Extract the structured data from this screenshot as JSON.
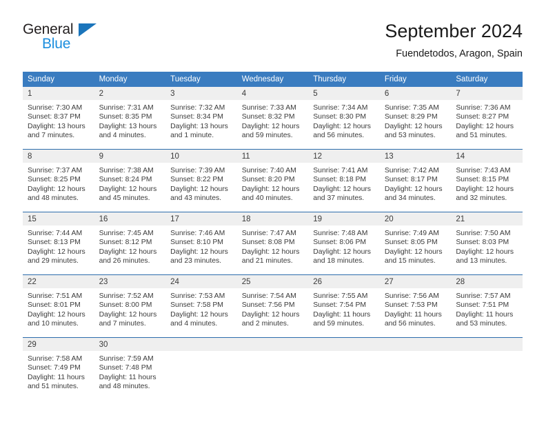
{
  "brand": {
    "name_top": "General",
    "name_bottom": "Blue",
    "triangle_color": "#1b75bb",
    "blue_color": "#1b8ede"
  },
  "header": {
    "title": "September 2024",
    "subtitle": "Fuendetodos, Aragon, Spain"
  },
  "theme": {
    "header_bg": "#3a7cc0",
    "daynum_bg": "#efefef",
    "rule_color": "#2b6cac",
    "text_color": "#3a3a3a"
  },
  "weekdays": [
    "Sunday",
    "Monday",
    "Tuesday",
    "Wednesday",
    "Thursday",
    "Friday",
    "Saturday"
  ],
  "weeks": [
    [
      {
        "day": "1",
        "sunrise": "Sunrise: 7:30 AM",
        "sunset": "Sunset: 8:37 PM",
        "daylight1": "Daylight: 13 hours",
        "daylight2": "and 7 minutes."
      },
      {
        "day": "2",
        "sunrise": "Sunrise: 7:31 AM",
        "sunset": "Sunset: 8:35 PM",
        "daylight1": "Daylight: 13 hours",
        "daylight2": "and 4 minutes."
      },
      {
        "day": "3",
        "sunrise": "Sunrise: 7:32 AM",
        "sunset": "Sunset: 8:34 PM",
        "daylight1": "Daylight: 13 hours",
        "daylight2": "and 1 minute."
      },
      {
        "day": "4",
        "sunrise": "Sunrise: 7:33 AM",
        "sunset": "Sunset: 8:32 PM",
        "daylight1": "Daylight: 12 hours",
        "daylight2": "and 59 minutes."
      },
      {
        "day": "5",
        "sunrise": "Sunrise: 7:34 AM",
        "sunset": "Sunset: 8:30 PM",
        "daylight1": "Daylight: 12 hours",
        "daylight2": "and 56 minutes."
      },
      {
        "day": "6",
        "sunrise": "Sunrise: 7:35 AM",
        "sunset": "Sunset: 8:29 PM",
        "daylight1": "Daylight: 12 hours",
        "daylight2": "and 53 minutes."
      },
      {
        "day": "7",
        "sunrise": "Sunrise: 7:36 AM",
        "sunset": "Sunset: 8:27 PM",
        "daylight1": "Daylight: 12 hours",
        "daylight2": "and 51 minutes."
      }
    ],
    [
      {
        "day": "8",
        "sunrise": "Sunrise: 7:37 AM",
        "sunset": "Sunset: 8:25 PM",
        "daylight1": "Daylight: 12 hours",
        "daylight2": "and 48 minutes."
      },
      {
        "day": "9",
        "sunrise": "Sunrise: 7:38 AM",
        "sunset": "Sunset: 8:24 PM",
        "daylight1": "Daylight: 12 hours",
        "daylight2": "and 45 minutes."
      },
      {
        "day": "10",
        "sunrise": "Sunrise: 7:39 AM",
        "sunset": "Sunset: 8:22 PM",
        "daylight1": "Daylight: 12 hours",
        "daylight2": "and 43 minutes."
      },
      {
        "day": "11",
        "sunrise": "Sunrise: 7:40 AM",
        "sunset": "Sunset: 8:20 PM",
        "daylight1": "Daylight: 12 hours",
        "daylight2": "and 40 minutes."
      },
      {
        "day": "12",
        "sunrise": "Sunrise: 7:41 AM",
        "sunset": "Sunset: 8:18 PM",
        "daylight1": "Daylight: 12 hours",
        "daylight2": "and 37 minutes."
      },
      {
        "day": "13",
        "sunrise": "Sunrise: 7:42 AM",
        "sunset": "Sunset: 8:17 PM",
        "daylight1": "Daylight: 12 hours",
        "daylight2": "and 34 minutes."
      },
      {
        "day": "14",
        "sunrise": "Sunrise: 7:43 AM",
        "sunset": "Sunset: 8:15 PM",
        "daylight1": "Daylight: 12 hours",
        "daylight2": "and 32 minutes."
      }
    ],
    [
      {
        "day": "15",
        "sunrise": "Sunrise: 7:44 AM",
        "sunset": "Sunset: 8:13 PM",
        "daylight1": "Daylight: 12 hours",
        "daylight2": "and 29 minutes."
      },
      {
        "day": "16",
        "sunrise": "Sunrise: 7:45 AM",
        "sunset": "Sunset: 8:12 PM",
        "daylight1": "Daylight: 12 hours",
        "daylight2": "and 26 minutes."
      },
      {
        "day": "17",
        "sunrise": "Sunrise: 7:46 AM",
        "sunset": "Sunset: 8:10 PM",
        "daylight1": "Daylight: 12 hours",
        "daylight2": "and 23 minutes."
      },
      {
        "day": "18",
        "sunrise": "Sunrise: 7:47 AM",
        "sunset": "Sunset: 8:08 PM",
        "daylight1": "Daylight: 12 hours",
        "daylight2": "and 21 minutes."
      },
      {
        "day": "19",
        "sunrise": "Sunrise: 7:48 AM",
        "sunset": "Sunset: 8:06 PM",
        "daylight1": "Daylight: 12 hours",
        "daylight2": "and 18 minutes."
      },
      {
        "day": "20",
        "sunrise": "Sunrise: 7:49 AM",
        "sunset": "Sunset: 8:05 PM",
        "daylight1": "Daylight: 12 hours",
        "daylight2": "and 15 minutes."
      },
      {
        "day": "21",
        "sunrise": "Sunrise: 7:50 AM",
        "sunset": "Sunset: 8:03 PM",
        "daylight1": "Daylight: 12 hours",
        "daylight2": "and 13 minutes."
      }
    ],
    [
      {
        "day": "22",
        "sunrise": "Sunrise: 7:51 AM",
        "sunset": "Sunset: 8:01 PM",
        "daylight1": "Daylight: 12 hours",
        "daylight2": "and 10 minutes."
      },
      {
        "day": "23",
        "sunrise": "Sunrise: 7:52 AM",
        "sunset": "Sunset: 8:00 PM",
        "daylight1": "Daylight: 12 hours",
        "daylight2": "and 7 minutes."
      },
      {
        "day": "24",
        "sunrise": "Sunrise: 7:53 AM",
        "sunset": "Sunset: 7:58 PM",
        "daylight1": "Daylight: 12 hours",
        "daylight2": "and 4 minutes."
      },
      {
        "day": "25",
        "sunrise": "Sunrise: 7:54 AM",
        "sunset": "Sunset: 7:56 PM",
        "daylight1": "Daylight: 12 hours",
        "daylight2": "and 2 minutes."
      },
      {
        "day": "26",
        "sunrise": "Sunrise: 7:55 AM",
        "sunset": "Sunset: 7:54 PM",
        "daylight1": "Daylight: 11 hours",
        "daylight2": "and 59 minutes."
      },
      {
        "day": "27",
        "sunrise": "Sunrise: 7:56 AM",
        "sunset": "Sunset: 7:53 PM",
        "daylight1": "Daylight: 11 hours",
        "daylight2": "and 56 minutes."
      },
      {
        "day": "28",
        "sunrise": "Sunrise: 7:57 AM",
        "sunset": "Sunset: 7:51 PM",
        "daylight1": "Daylight: 11 hours",
        "daylight2": "and 53 minutes."
      }
    ],
    [
      {
        "day": "29",
        "sunrise": "Sunrise: 7:58 AM",
        "sunset": "Sunset: 7:49 PM",
        "daylight1": "Daylight: 11 hours",
        "daylight2": "and 51 minutes."
      },
      {
        "day": "30",
        "sunrise": "Sunrise: 7:59 AM",
        "sunset": "Sunset: 7:48 PM",
        "daylight1": "Daylight: 11 hours",
        "daylight2": "and 48 minutes."
      },
      {
        "day": "",
        "sunrise": "",
        "sunset": "",
        "daylight1": "",
        "daylight2": ""
      },
      {
        "day": "",
        "sunrise": "",
        "sunset": "",
        "daylight1": "",
        "daylight2": ""
      },
      {
        "day": "",
        "sunrise": "",
        "sunset": "",
        "daylight1": "",
        "daylight2": ""
      },
      {
        "day": "",
        "sunrise": "",
        "sunset": "",
        "daylight1": "",
        "daylight2": ""
      },
      {
        "day": "",
        "sunrise": "",
        "sunset": "",
        "daylight1": "",
        "daylight2": ""
      }
    ]
  ]
}
